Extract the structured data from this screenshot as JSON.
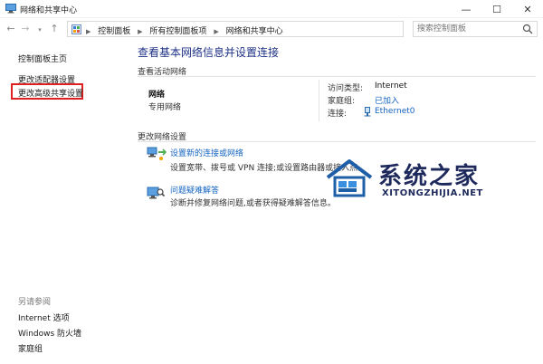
{
  "window": {
    "title": "网络和共享中心",
    "controls": {
      "minimize": "—",
      "maximize": "☐",
      "close": "✕"
    }
  },
  "address_bar": {
    "breadcrumbs": [
      "控制面板",
      "所有控制面板项",
      "网络和共享中心"
    ],
    "search_placeholder": "搜索控制面板"
  },
  "sidebar": {
    "links": {
      "home": "控制面板主页",
      "adapter": "更改适配器设置",
      "advanced_sharing": "更改高级共享设置"
    },
    "see_also_heading": "另请参阅",
    "see_also": {
      "internet_options": "Internet 选项",
      "firewall": "Windows 防火墙",
      "homegroup": "家庭组"
    }
  },
  "main": {
    "title": "查看基本网络信息并设置连接",
    "active_networks_heading": "查看活动网络",
    "network": {
      "name": "网络",
      "type": "专用网络",
      "access_type_label": "访问类型:",
      "access_type_value": "Internet",
      "homegroup_label": "家庭组:",
      "homegroup_value": "已加入",
      "connections_label": "连接:",
      "connections_value": "Ethernet0"
    },
    "change_heading": "更改网络设置",
    "tasks": {
      "new_connection": {
        "link": "设置新的连接或网络",
        "desc": "设置宽带、拨号或 VPN 连接;或设置路由器或接入点。"
      },
      "troubleshoot": {
        "link": "问题疑难解答",
        "desc": "诊断并修复网络问题,或者获得疑难解答信息。"
      }
    }
  },
  "watermark": {
    "text": "系统之家",
    "url": "XITONGZHIJIA.NET"
  },
  "colors": {
    "link": "#1665c0",
    "title": "#1e3287",
    "highlight_border": "#e02020"
  }
}
